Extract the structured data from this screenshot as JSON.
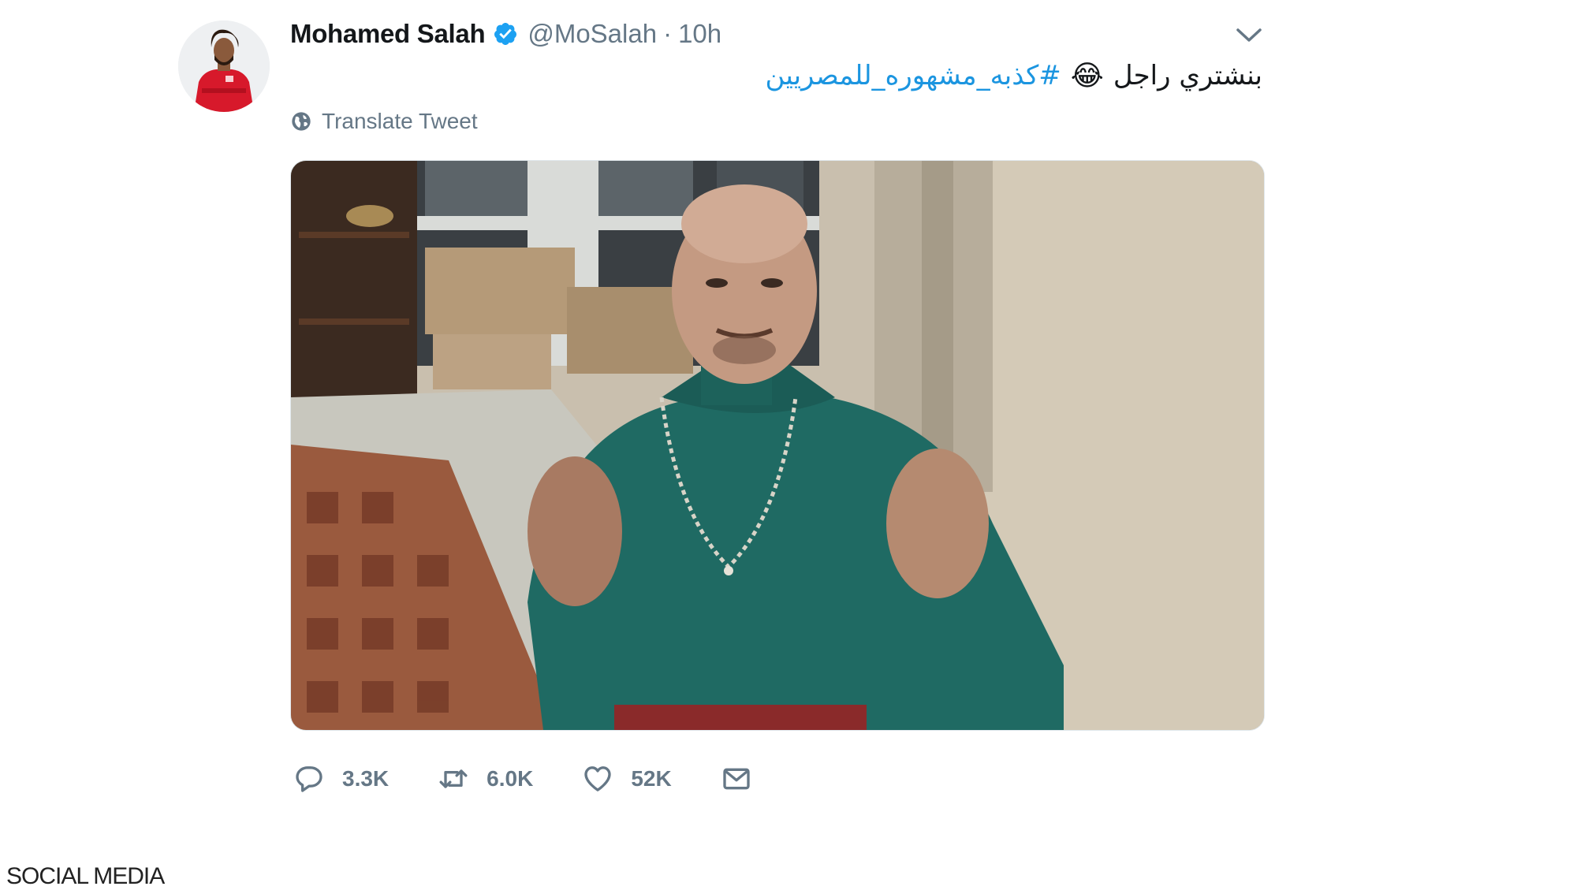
{
  "tweet": {
    "author_name": "Mohamed Salah",
    "handle": "@MoSalah",
    "separator": "·",
    "time": "10h",
    "text_words": "بنشتري راجل",
    "text_emoji": "😂",
    "text_hashtag": "#كذبه_مشهوره_للمصريين",
    "translate_label": "Translate Tweet",
    "media_alt": "Video still: man in a teal turtleneck gesturing with both hands"
  },
  "actions": {
    "replies": "3.3K",
    "retweets": "6.0K",
    "likes": "52K"
  },
  "watermark": "SOCIAL MEDIA",
  "icons": {
    "verified": "verified-badge-icon",
    "caret": "chevron-down-icon",
    "translate": "globe-icon",
    "reply": "reply-bubble-icon",
    "retweet": "retweet-icon",
    "like": "heart-icon",
    "dm": "envelope-icon"
  },
  "colors": {
    "name": "#14171a",
    "muted": "#657786",
    "link": "#1b95e0",
    "verified": "#1da1f2"
  }
}
